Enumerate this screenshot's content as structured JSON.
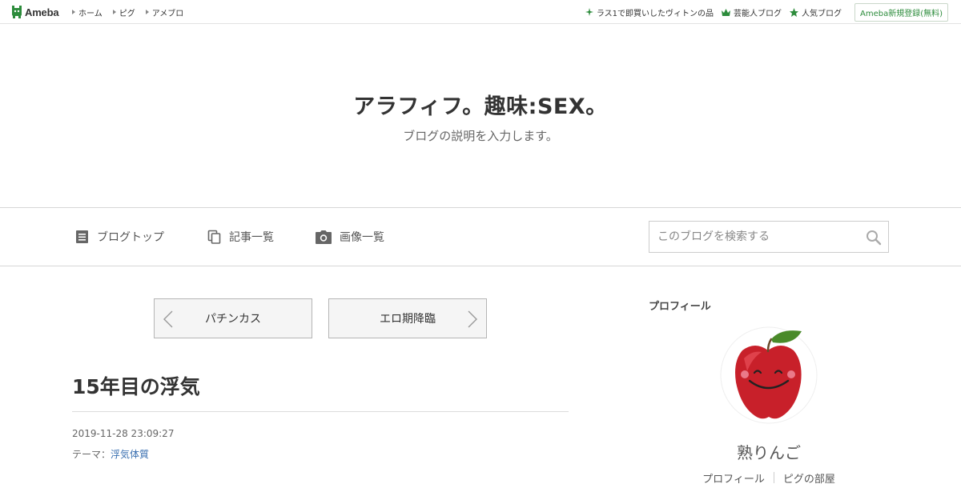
{
  "topbar": {
    "logo_text": "Ameba",
    "nav": [
      {
        "label": "ホーム"
      },
      {
        "label": "ピグ"
      },
      {
        "label": "アメブロ"
      }
    ],
    "right_links": [
      {
        "label": "ラス1で即買いしたヴィトンの品",
        "icon": "sparkle-icon"
      },
      {
        "label": "芸能人ブログ",
        "icon": "crown-icon"
      },
      {
        "label": "人気ブログ",
        "icon": "star-icon"
      }
    ],
    "register_label": "Ameba新規登録(無料)",
    "accent": "#2d8c3c"
  },
  "blog": {
    "title": "アラフィフ。趣味:SEX。",
    "description": "ブログの説明を入力します。"
  },
  "blog_nav": {
    "items": [
      {
        "label": "ブログトップ",
        "icon": "document-icon"
      },
      {
        "label": "記事一覧",
        "icon": "copy-icon"
      },
      {
        "label": "画像一覧",
        "icon": "camera-icon"
      }
    ],
    "search_placeholder": "このブログを検索する"
  },
  "pager": {
    "prev_label": "パチンカス",
    "next_label": "エロ期降臨"
  },
  "article": {
    "title": "15年目の浮気",
    "date": "2019-11-28 23:09:27",
    "theme_prefix": "テーマ：",
    "theme": "浮気体質",
    "link_color": "#3a6fb0"
  },
  "sidebar": {
    "heading": "プロフィール",
    "name": "熟りんご",
    "links": [
      {
        "label": "プロフィール"
      },
      {
        "label": "ピグの部屋"
      }
    ]
  }
}
